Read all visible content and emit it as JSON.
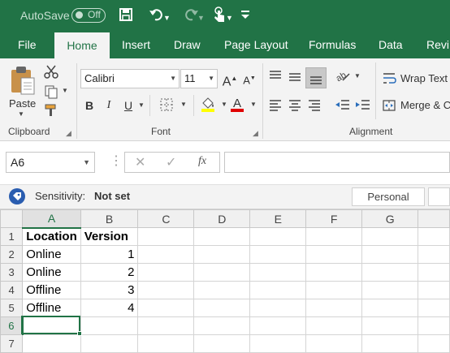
{
  "titlebar": {
    "autosave_label": "AutoSave",
    "autosave_state": "Off",
    "bg_color": "#217346"
  },
  "tabs": [
    "File",
    "Home",
    "Insert",
    "Draw",
    "Page Layout",
    "Formulas",
    "Data",
    "Revi"
  ],
  "active_tab": "Home",
  "ribbon": {
    "clipboard": {
      "paste_label": "Paste",
      "group_label": "Clipboard"
    },
    "font": {
      "font_name": "Calibri",
      "font_size": "11",
      "group_label": "Font",
      "bold": "B",
      "italic": "I",
      "underline": "U",
      "grow": "A",
      "shrink": "A",
      "fill_color": "#ffff00",
      "font_color": "#e00000"
    },
    "alignment": {
      "wrap_text": "Wrap Text",
      "merge": "Merge & C",
      "group_label": "Alignment"
    }
  },
  "formula_bar": {
    "name_box": "A6",
    "fx": "fx",
    "formula": ""
  },
  "sensitivity": {
    "label": "Sensitivity:",
    "value": "Not set",
    "personal": "Personal"
  },
  "sheet": {
    "columns": [
      "A",
      "B",
      "C",
      "D",
      "E",
      "F",
      "G"
    ],
    "rows": [
      {
        "num": "1",
        "A": "Location",
        "B": "Version"
      },
      {
        "num": "2",
        "A": "Online",
        "B": "1"
      },
      {
        "num": "3",
        "A": "Online",
        "B": "2"
      },
      {
        "num": "4",
        "A": "Offline",
        "B": "3"
      },
      {
        "num": "5",
        "A": "Offline",
        "B": "4"
      },
      {
        "num": "6",
        "A": "",
        "B": ""
      },
      {
        "num": "7",
        "A": "",
        "B": ""
      }
    ],
    "selected_cell": "A6"
  }
}
